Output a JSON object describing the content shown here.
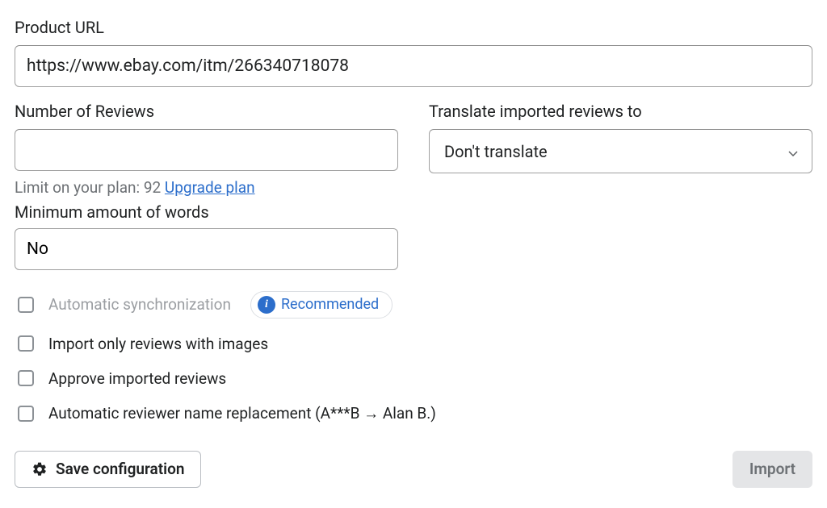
{
  "productUrl": {
    "label": "Product URL",
    "value": "https://www.ebay.com/itm/266340718078"
  },
  "reviewCount": {
    "label": "Number of Reviews",
    "value": "",
    "limitPrefix": "Limit on your plan: 92 ",
    "upgradeText": "Upgrade plan"
  },
  "translate": {
    "label": "Translate imported reviews to",
    "selected": "Don't translate"
  },
  "minWords": {
    "label": "Minimum amount of words",
    "value": "No"
  },
  "checkboxes": {
    "autoSync": "Automatic synchronization",
    "recommended": "Recommended",
    "imagesOnly": "Import only reviews with images",
    "approve": "Approve imported reviews",
    "nameReplace": "Automatic reviewer name replacement (A***B → Alan B.)"
  },
  "buttons": {
    "save": "Save configuration",
    "import": "Import"
  }
}
